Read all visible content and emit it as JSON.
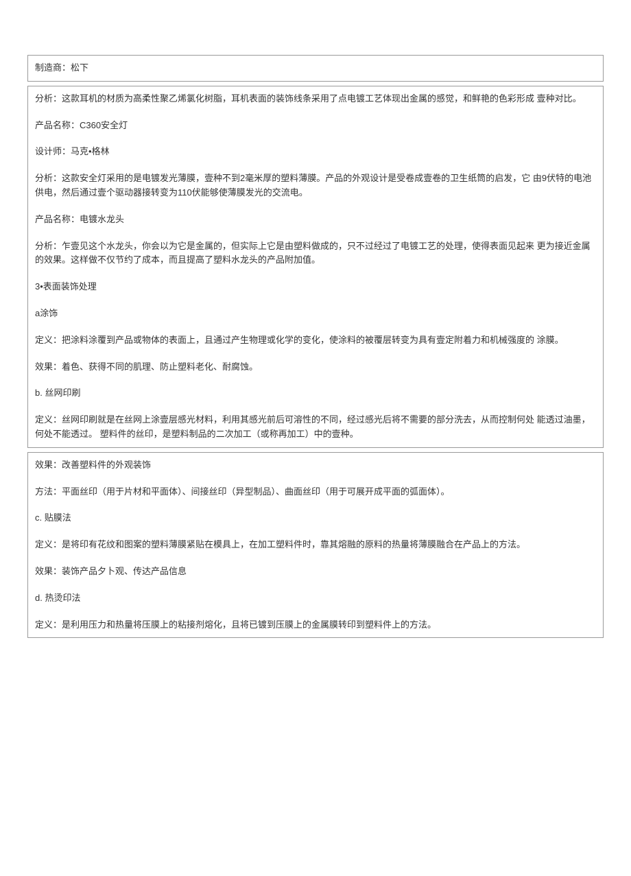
{
  "box1": {
    "line1": "制造商：松下"
  },
  "box2": {
    "p1": "分析：这款耳机的材质为高柔性聚乙烯氯化树脂，耳机表面的装饰线条采用了点电镀工艺体现出金属的感觉，和鲜艳的色彩形成 壹种对比。",
    "p2": "产品名称：C360安全灯",
    "p3": "设计师：马克•格林",
    "p4": "分析：这款安全灯采用的是电镀发光薄膜，壹种不到2毫米厚的塑料薄膜。产品的外观设计是受卷成壹卷的卫生纸筒的启发，它 由9伏特的电池供电，然后通过壹个驱动器接转变为110伏能够使薄膜发光的交流电。",
    "p5": "产品名称：电镀水龙头",
    "p6": "分析：乍壹见这个水龙头，你会以为它是金属的，但实际上它是由塑料做成的，只不过经过了电镀工艺的处理，使得表面见起来 更为接近金属的效果。这样做不仅节约了成本，而且提高了塑料水龙头的产品附加值。",
    "p7": "3•表面装饰处理",
    "p8": "a涂饰",
    "p9": "定义：把涂料涂覆到产品或物体的表面上，且通过产生物理或化学的变化，使涂料的被覆层转变为具有壹定附着力和机械强度的 涂膜。",
    "p10": "效果：着色、获得不同的肌理、防止塑料老化、耐腐蚀。",
    "p11": "b.  丝网印刷",
    "p12": "定义：丝网印刷就是在丝网上涂壹层感光材料，利用其感光前后可溶性的不同，经过感光后将不需要的部分洗去，从而控制何处 能透过油墨，何处不能透过。 塑料件的丝印，是塑料制品的二次加工（或称再加工）中的壹种。"
  },
  "box3": {
    "p1": "效果：改善塑料件的外观装饰",
    "p2": "方法：平面丝印（用于片材和平面体）、间接丝印（异型制品）、曲面丝印（用于可展开成平面的弧面体）。",
    "p3": "c.  贴膜法",
    "p4": "定义：是将印有花纹和图案的塑料薄膜紧贴在模具上，在加工塑料件时，靠其熔融的原料的热量将薄膜融合在产品上的方法。",
    "p5": "效果：装饰产品夕卜观、传达产品信息",
    "p6": "d.  热烫印法",
    "p7": "定义：是利用压力和热量将压膜上的粘接剂熔化，且将已镀到压膜上的金属膜转印到塑料件上的方法。"
  }
}
